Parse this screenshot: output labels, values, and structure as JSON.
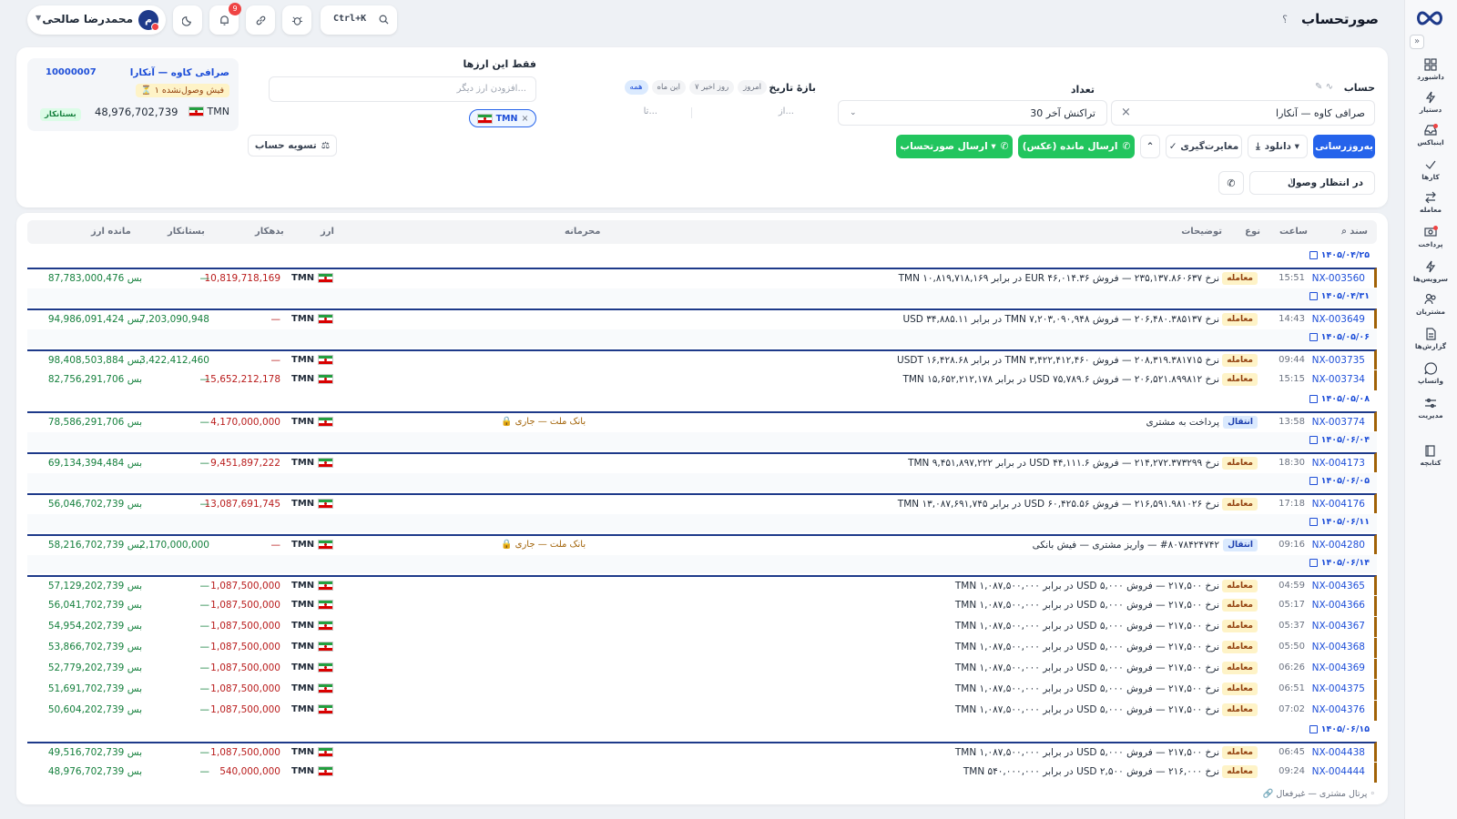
{
  "page": {
    "title": "صورتحساب",
    "help": "؟"
  },
  "topbar": {
    "user_name": "محمدرضا صالحی",
    "avatar_letter": "م",
    "notif_count": "9",
    "search_shortcut": "Ctrl+K"
  },
  "sidebar": [
    {
      "label": "داشبورد",
      "icon": "dashboard-icon"
    },
    {
      "label": "دستیار",
      "icon": "bolt-icon"
    },
    {
      "label": "اینباکس",
      "icon": "inbox-icon"
    },
    {
      "label": "کارها",
      "icon": "check-icon"
    },
    {
      "label": "معامله",
      "icon": "swap-icon"
    },
    {
      "label": "پرداخت",
      "icon": "payment-icon"
    },
    {
      "label": "سرویس‌ها",
      "icon": "bolt-icon"
    },
    {
      "label": "مشتریان",
      "icon": "users-icon"
    },
    {
      "label": "گزارش‌ها",
      "icon": "report-icon"
    },
    {
      "label": "واتساپ",
      "icon": "chat-icon"
    },
    {
      "label": "مدیریت",
      "icon": "manage-icon"
    },
    {
      "label": "کتابچه",
      "icon": "book-icon"
    }
  ],
  "filters": {
    "account_label": "حساب",
    "account_value": "صرافی کاوه — آنکارا",
    "count_label": "تعداد",
    "count_value": "30 تراکنش آخر",
    "date_label": "بازهٔ تاریخ",
    "date_chips": [
      "همه",
      "این ماه",
      "۷ روز اخیر",
      "امروز"
    ],
    "date_from": "از...",
    "date_to": "تا...",
    "currency_label": "فقط این ارزها",
    "currency_placeholder": "افزودن ارز دیگر...",
    "currency_chip": "TMN"
  },
  "actions": {
    "refresh": "به‌روزرسانی",
    "download": "دانلود ▾",
    "reconcile": "✓ مغایرت‌گیری",
    "send_balance": "ارسال مانده (عکس)",
    "send_statement": "ارسال صورتحساب ▾",
    "settle": "تسویه حساب",
    "pending_label": "در انتظار وصول",
    "pending_count": "۱"
  },
  "balance_card": {
    "name": "صرافی کاوه — آنکارا",
    "code": "10000007",
    "warning": "۱ فیش وصول‌نشده",
    "currency": "TMN",
    "amount": "48,976,702,739",
    "state": "بستانکار"
  },
  "table": {
    "headers": {
      "doc": "سند",
      "time": "ساعت",
      "type": "نوع",
      "desc": "توضیحات",
      "conf": "محرمانه",
      "cur": "ارز",
      "debit": "بدهکار",
      "credit": "بستانکار",
      "bal": "مانده ارز"
    },
    "items": [
      {
        "kind": "date",
        "date": "۱۴۰۵/۰۴/۲۵"
      },
      {
        "kind": "row",
        "doc": "NX-003560",
        "time": "15:51",
        "type": "معامله",
        "desc": "نرخ ۲۳۵,۱۳۷.۸۶۰۶۳۷ — فروش ۴۶,۰۱۴.۳۶ EUR در برابر ۱۰,۸۱۹,۷۱۸,۱۶۹ TMN",
        "conf": "",
        "cur": "TMN",
        "debit": "10,819,718,169",
        "credit": "—",
        "bal": "87,783,000,476 بس",
        "first": true
      },
      {
        "kind": "date",
        "date": "۱۴۰۵/۰۴/۳۱",
        "shaded": true
      },
      {
        "kind": "row",
        "doc": "NX-003649",
        "time": "14:43",
        "type": "معامله",
        "desc": "نرخ ۲۰۶,۴۸۰.۳۸۵۱۳۷ — فروش ۷,۲۰۳,۰۹۰,۹۴۸ TMN در برابر ۳۴,۸۸۵.۱۱ USD",
        "conf": "",
        "cur": "TMN",
        "debit": "—",
        "credit": "7,203,090,948",
        "bal": "94,986,091,424 بس",
        "first": true
      },
      {
        "kind": "date",
        "date": "۱۴۰۵/۰۵/۰۶",
        "shaded": true
      },
      {
        "kind": "row",
        "doc": "NX-003735",
        "time": "09:44",
        "type": "معامله",
        "desc": "نرخ ۲۰۸,۳۱۹.۳۸۱۷۱۵ — فروش ۳,۴۲۲,۴۱۲,۴۶۰ TMN در برابر ۱۶,۴۲۸.۶۸ USDT",
        "conf": "",
        "cur": "TMN",
        "debit": "—",
        "credit": "3,422,412,460",
        "bal": "98,408,503,884 بس",
        "first": true
      },
      {
        "kind": "row",
        "doc": "NX-003734",
        "time": "15:15",
        "type": "معامله",
        "desc": "نرخ ۲۰۶,۵۲۱.۸۹۹۸۱۲ — فروش ۷۵,۷۸۹.۶ USD در برابر ۱۵,۶۵۲,۲۱۲,۱۷۸ TMN",
        "conf": "",
        "cur": "TMN",
        "debit": "15,652,212,178",
        "credit": "—",
        "bal": "82,756,291,706 بس"
      },
      {
        "kind": "date",
        "date": "۱۴۰۵/۰۵/۰۸"
      },
      {
        "kind": "row",
        "doc": "NX-003774",
        "time": "13:58",
        "type": "انتقال",
        "desc": "پرداخت به مشتری",
        "conf": "بانک ملت — جاری",
        "cur": "TMN",
        "debit": "4,170,000,000",
        "credit": "—",
        "bal": "78,586,291,706 بس",
        "first": true
      },
      {
        "kind": "date",
        "date": "۱۴۰۵/۰۶/۰۴",
        "shaded": true
      },
      {
        "kind": "row",
        "doc": "NX-004173",
        "time": "18:30",
        "type": "معامله",
        "desc": "نرخ ۲۱۴,۲۷۲.۳۷۳۲۹۹ — فروش ۴۴,۱۱۱.۶ USD در برابر ۹,۴۵۱,۸۹۷,۲۲۲ TMN",
        "conf": "",
        "cur": "TMN",
        "debit": "9,451,897,222",
        "credit": "—",
        "bal": "69,134,394,484 بس",
        "first": true
      },
      {
        "kind": "date",
        "date": "۱۴۰۵/۰۶/۰۵",
        "shaded": true
      },
      {
        "kind": "row",
        "doc": "NX-004176",
        "time": "17:18",
        "type": "معامله",
        "desc": "نرخ ۲۱۶,۵۹۱.۹۸۱۰۲۶ — فروش ۶۰,۴۲۵.۵۶ USD در برابر ۱۳,۰۸۷,۶۹۱,۷۴۵ TMN",
        "conf": "",
        "cur": "TMN",
        "debit": "13,087,691,745",
        "credit": "—",
        "bal": "56,046,702,739 بس",
        "first": true
      },
      {
        "kind": "date",
        "date": "۱۴۰۵/۰۶/۱۱",
        "shaded": true
      },
      {
        "kind": "row",
        "doc": "NX-004280",
        "time": "09:16",
        "type": "انتقال",
        "desc": "#۸۰۷۸۴۲۴۷۴۲ — واریز مشتری — فیش بانکی",
        "conf": "بانک ملت — جاری",
        "cur": "TMN",
        "debit": "—",
        "credit": "2,170,000,000",
        "bal": "58,216,702,739 بس",
        "first": true
      },
      {
        "kind": "date",
        "date": "۱۴۰۵/۰۶/۱۴",
        "shaded": true
      },
      {
        "kind": "row",
        "doc": "NX-004365",
        "time": "04:59",
        "type": "معامله",
        "desc": "نرخ ۲۱۷,۵۰۰ — فروش ۵,۰۰۰ USD در برابر ۱,۰۸۷,۵۰۰,۰۰۰ TMN",
        "conf": "",
        "cur": "TMN",
        "debit": "1,087,500,000",
        "credit": "—",
        "bal": "57,129,202,739 بس",
        "first": true
      },
      {
        "kind": "row",
        "doc": "NX-004366",
        "time": "05:17",
        "type": "معامله",
        "desc": "نرخ ۲۱۷,۵۰۰ — فروش ۵,۰۰۰ USD در برابر ۱,۰۸۷,۵۰۰,۰۰۰ TMN",
        "conf": "",
        "cur": "TMN",
        "debit": "1,087,500,000",
        "credit": "—",
        "bal": "56,041,702,739 بس"
      },
      {
        "kind": "row",
        "doc": "NX-004367",
        "time": "05:37",
        "type": "معامله",
        "desc": "نرخ ۲۱۷,۵۰۰ — فروش ۵,۰۰۰ USD در برابر ۱,۰۸۷,۵۰۰,۰۰۰ TMN",
        "conf": "",
        "cur": "TMN",
        "debit": "1,087,500,000",
        "credit": "—",
        "bal": "54,954,202,739 بس"
      },
      {
        "kind": "row",
        "doc": "NX-004368",
        "time": "05:50",
        "type": "معامله",
        "desc": "نرخ ۲۱۷,۵۰۰ — فروش ۵,۰۰۰ USD در برابر ۱,۰۸۷,۵۰۰,۰۰۰ TMN",
        "conf": "",
        "cur": "TMN",
        "debit": "1,087,500,000",
        "credit": "—",
        "bal": "53,866,702,739 بس"
      },
      {
        "kind": "row",
        "doc": "NX-004369",
        "time": "06:26",
        "type": "معامله",
        "desc": "نرخ ۲۱۷,۵۰۰ — فروش ۵,۰۰۰ USD در برابر ۱,۰۸۷,۵۰۰,۰۰۰ TMN",
        "conf": "",
        "cur": "TMN",
        "debit": "1,087,500,000",
        "credit": "—",
        "bal": "52,779,202,739 بس"
      },
      {
        "kind": "row",
        "doc": "NX-004375",
        "time": "06:51",
        "type": "معامله",
        "desc": "نرخ ۲۱۷,۵۰۰ — فروش ۵,۰۰۰ USD در برابر ۱,۰۸۷,۵۰۰,۰۰۰ TMN",
        "conf": "",
        "cur": "TMN",
        "debit": "1,087,500,000",
        "credit": "—",
        "bal": "51,691,702,739 بس"
      },
      {
        "kind": "row",
        "doc": "NX-004376",
        "time": "07:02",
        "type": "معامله",
        "desc": "نرخ ۲۱۷,۵۰۰ — فروش ۵,۰۰۰ USD در برابر ۱,۰۸۷,۵۰۰,۰۰۰ TMN",
        "conf": "",
        "cur": "TMN",
        "debit": "1,087,500,000",
        "credit": "—",
        "bal": "50,604,202,739 بس"
      },
      {
        "kind": "date",
        "date": "۱۴۰۵/۰۶/۱۵"
      },
      {
        "kind": "row",
        "doc": "NX-004438",
        "time": "06:45",
        "type": "معامله",
        "desc": "نرخ ۲۱۷,۵۰۰ — فروش ۵,۰۰۰ USD در برابر ۱,۰۸۷,۵۰۰,۰۰۰ TMN",
        "conf": "",
        "cur": "TMN",
        "debit": "1,087,500,000",
        "credit": "—",
        "bal": "49,516,702,739 بس",
        "first": true
      },
      {
        "kind": "row",
        "doc": "NX-004444",
        "time": "09:24",
        "type": "معامله",
        "desc": "نرخ ۲۱۶,۰۰۰ — فروش ۲,۵۰۰ USD در برابر ۵۴۰,۰۰۰,۰۰۰ TMN",
        "conf": "",
        "cur": "TMN",
        "debit": "540,000,000",
        "credit": "—",
        "bal": "48,976,702,739 بس"
      }
    ]
  },
  "footer": {
    "portal": "پرتال مشتری — غیرفعال"
  },
  "colors": {
    "primary": "#2563eb",
    "green": "#22c55e",
    "debit": "#b91c1c",
    "credit": "#15803d",
    "trade_badge": "#fef3c7",
    "transfer_badge": "#dbeafe"
  }
}
